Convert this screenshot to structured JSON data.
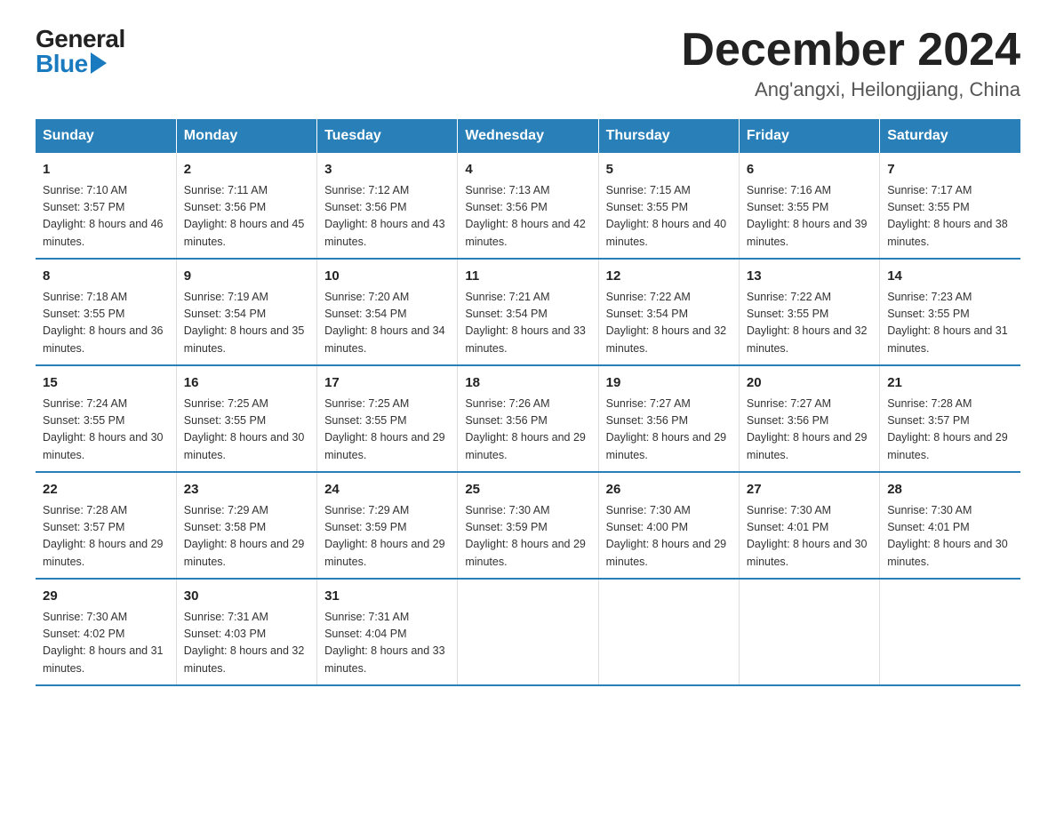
{
  "logo": {
    "general": "General",
    "blue": "Blue"
  },
  "title": "December 2024",
  "location": "Ang'angxi, Heilongjiang, China",
  "columns": [
    "Sunday",
    "Monday",
    "Tuesday",
    "Wednesday",
    "Thursday",
    "Friday",
    "Saturday"
  ],
  "weeks": [
    [
      {
        "day": "1",
        "sunrise": "7:10 AM",
        "sunset": "3:57 PM",
        "daylight": "8 hours and 46 minutes."
      },
      {
        "day": "2",
        "sunrise": "7:11 AM",
        "sunset": "3:56 PM",
        "daylight": "8 hours and 45 minutes."
      },
      {
        "day": "3",
        "sunrise": "7:12 AM",
        "sunset": "3:56 PM",
        "daylight": "8 hours and 43 minutes."
      },
      {
        "day": "4",
        "sunrise": "7:13 AM",
        "sunset": "3:56 PM",
        "daylight": "8 hours and 42 minutes."
      },
      {
        "day": "5",
        "sunrise": "7:15 AM",
        "sunset": "3:55 PM",
        "daylight": "8 hours and 40 minutes."
      },
      {
        "day": "6",
        "sunrise": "7:16 AM",
        "sunset": "3:55 PM",
        "daylight": "8 hours and 39 minutes."
      },
      {
        "day": "7",
        "sunrise": "7:17 AM",
        "sunset": "3:55 PM",
        "daylight": "8 hours and 38 minutes."
      }
    ],
    [
      {
        "day": "8",
        "sunrise": "7:18 AM",
        "sunset": "3:55 PM",
        "daylight": "8 hours and 36 minutes."
      },
      {
        "day": "9",
        "sunrise": "7:19 AM",
        "sunset": "3:54 PM",
        "daylight": "8 hours and 35 minutes."
      },
      {
        "day": "10",
        "sunrise": "7:20 AM",
        "sunset": "3:54 PM",
        "daylight": "8 hours and 34 minutes."
      },
      {
        "day": "11",
        "sunrise": "7:21 AM",
        "sunset": "3:54 PM",
        "daylight": "8 hours and 33 minutes."
      },
      {
        "day": "12",
        "sunrise": "7:22 AM",
        "sunset": "3:54 PM",
        "daylight": "8 hours and 32 minutes."
      },
      {
        "day": "13",
        "sunrise": "7:22 AM",
        "sunset": "3:55 PM",
        "daylight": "8 hours and 32 minutes."
      },
      {
        "day": "14",
        "sunrise": "7:23 AM",
        "sunset": "3:55 PM",
        "daylight": "8 hours and 31 minutes."
      }
    ],
    [
      {
        "day": "15",
        "sunrise": "7:24 AM",
        "sunset": "3:55 PM",
        "daylight": "8 hours and 30 minutes."
      },
      {
        "day": "16",
        "sunrise": "7:25 AM",
        "sunset": "3:55 PM",
        "daylight": "8 hours and 30 minutes."
      },
      {
        "day": "17",
        "sunrise": "7:25 AM",
        "sunset": "3:55 PM",
        "daylight": "8 hours and 29 minutes."
      },
      {
        "day": "18",
        "sunrise": "7:26 AM",
        "sunset": "3:56 PM",
        "daylight": "8 hours and 29 minutes."
      },
      {
        "day": "19",
        "sunrise": "7:27 AM",
        "sunset": "3:56 PM",
        "daylight": "8 hours and 29 minutes."
      },
      {
        "day": "20",
        "sunrise": "7:27 AM",
        "sunset": "3:56 PM",
        "daylight": "8 hours and 29 minutes."
      },
      {
        "day": "21",
        "sunrise": "7:28 AM",
        "sunset": "3:57 PM",
        "daylight": "8 hours and 29 minutes."
      }
    ],
    [
      {
        "day": "22",
        "sunrise": "7:28 AM",
        "sunset": "3:57 PM",
        "daylight": "8 hours and 29 minutes."
      },
      {
        "day": "23",
        "sunrise": "7:29 AM",
        "sunset": "3:58 PM",
        "daylight": "8 hours and 29 minutes."
      },
      {
        "day": "24",
        "sunrise": "7:29 AM",
        "sunset": "3:59 PM",
        "daylight": "8 hours and 29 minutes."
      },
      {
        "day": "25",
        "sunrise": "7:30 AM",
        "sunset": "3:59 PM",
        "daylight": "8 hours and 29 minutes."
      },
      {
        "day": "26",
        "sunrise": "7:30 AM",
        "sunset": "4:00 PM",
        "daylight": "8 hours and 29 minutes."
      },
      {
        "day": "27",
        "sunrise": "7:30 AM",
        "sunset": "4:01 PM",
        "daylight": "8 hours and 30 minutes."
      },
      {
        "day": "28",
        "sunrise": "7:30 AM",
        "sunset": "4:01 PM",
        "daylight": "8 hours and 30 minutes."
      }
    ],
    [
      {
        "day": "29",
        "sunrise": "7:30 AM",
        "sunset": "4:02 PM",
        "daylight": "8 hours and 31 minutes."
      },
      {
        "day": "30",
        "sunrise": "7:31 AM",
        "sunset": "4:03 PM",
        "daylight": "8 hours and 32 minutes."
      },
      {
        "day": "31",
        "sunrise": "7:31 AM",
        "sunset": "4:04 PM",
        "daylight": "8 hours and 33 minutes."
      },
      null,
      null,
      null,
      null
    ]
  ]
}
